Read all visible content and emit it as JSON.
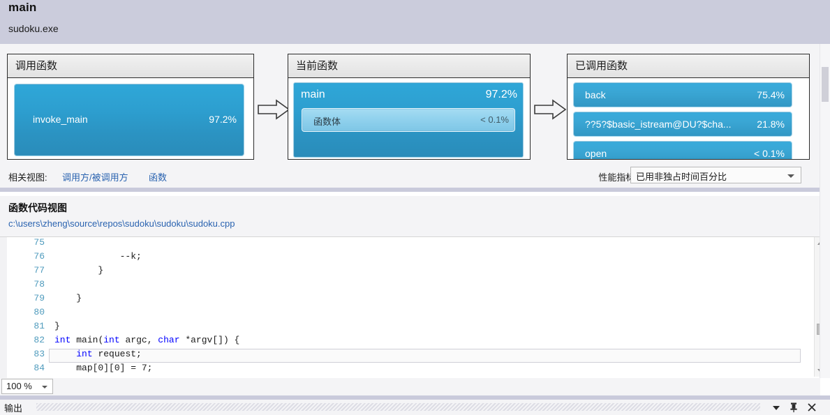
{
  "header": {
    "function_name": "main",
    "module": "sudoku.exe"
  },
  "caller_callee": {
    "caller_panel": {
      "title": "调用函数",
      "nodes": [
        {
          "name": "invoke_main",
          "percent": "97.2%"
        }
      ]
    },
    "current_panel": {
      "title": "当前函数",
      "node": {
        "name": "main",
        "percent": "97.2%"
      },
      "inner_node": {
        "name": "函数体",
        "percent": "< 0.1%"
      }
    },
    "callee_panel": {
      "title": "已调用函数",
      "nodes": [
        {
          "name": "back",
          "percent": "75.4%"
        },
        {
          "name": "??5?$basic_istream@DU?$cha...",
          "percent": "21.8%"
        },
        {
          "name": "open",
          "percent": "< 0.1%"
        }
      ]
    },
    "arrow_left_name": "arrow-caller-to-current",
    "arrow_right_name": "arrow-current-to-callee"
  },
  "related_views": {
    "label": "相关视图:",
    "links": [
      "调用方/被调用方",
      "函数"
    ]
  },
  "metric": {
    "label": "性能指标:",
    "selected": "已用非独占时间百分比"
  },
  "code_view": {
    "title": "函数代码视图",
    "file_path": "c:\\users\\zheng\\source\\repos\\sudoku\\sudoku\\sudoku.cpp",
    "lines": [
      {
        "number": "75",
        "text": ""
      },
      {
        "number": "76",
        "text": "            --k;"
      },
      {
        "number": "77",
        "text": "        }"
      },
      {
        "number": "78",
        "text": ""
      },
      {
        "number": "79",
        "text": "    }"
      },
      {
        "number": "80",
        "text": ""
      },
      {
        "number": "81",
        "text": "}"
      },
      {
        "number": "82",
        "text": "int main(int argc, char *argv[]) {"
      },
      {
        "number": "83",
        "text": "    int request;"
      },
      {
        "number": "84",
        "text": "    map[0][0] = 7;"
      }
    ],
    "highlighted_line": "83",
    "zoom": "100 %"
  },
  "output_panel": {
    "title": "输出"
  },
  "colors": {
    "header_bg": "#cbccdc",
    "node_blue": "#2d9fd0",
    "node_blue_light": "#93d3ee",
    "link_blue": "#2a63b0",
    "line_number": "#4f9bbd",
    "keyword": "#0000ff"
  }
}
